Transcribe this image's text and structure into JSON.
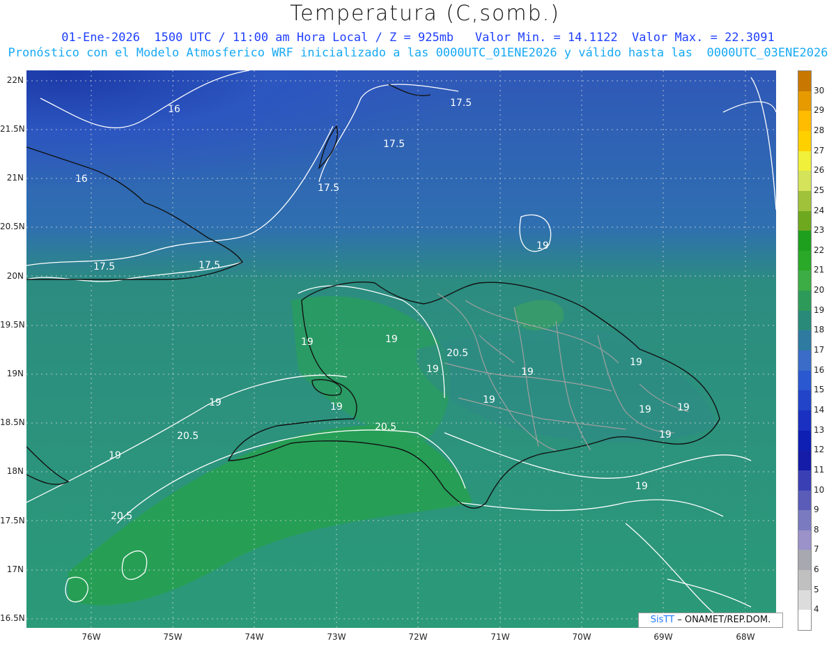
{
  "header": {
    "title": "Temperatura (C,somb.)",
    "line1": "01-Ene-2026  1500 UTC / 11:00 am Hora Local / Z = 925mb   Valor Min. = 14.1122  Valor Max. = 22.3091",
    "line2": "Pronóstico con el Modelo Atmosferico WRF inicializado a las 0000UTC_01ENE2026 y válido hasta las  0000UTC_03ENE2026"
  },
  "axes": {
    "y_labels": [
      "22N",
      "21.5N",
      "21N",
      "20.5N",
      "20N",
      "19.5N",
      "19N",
      "18.5N",
      "18N",
      "17.5N",
      "17N",
      "16.5N"
    ],
    "x_labels": [
      "76W",
      "75W",
      "74W",
      "73W",
      "72W",
      "71W",
      "70W",
      "69W",
      "68W"
    ]
  },
  "contour_labels": [
    "16",
    "16",
    "17.5",
    "17.5",
    "17.5",
    "17.5",
    "17.5",
    "19",
    "19",
    "19",
    "19",
    "19",
    "19",
    "19",
    "19",
    "19",
    "19",
    "19",
    "19",
    "19",
    "19",
    "20.5",
    "20.5",
    "20.5",
    "20.5"
  ],
  "colorbar": {
    "labels": [
      "30",
      "29",
      "28",
      "27",
      "26",
      "25",
      "24",
      "23",
      "22",
      "21",
      "20",
      "19",
      "18",
      "17",
      "16",
      "15",
      "14",
      "13",
      "12",
      "11",
      "10",
      "9",
      "8",
      "7",
      "6",
      "5",
      "4"
    ],
    "colors": [
      "#c87800",
      "#e69a00",
      "#ffbc00",
      "#ffd000",
      "#f0f03a",
      "#d4e35a",
      "#a0c23a",
      "#6ea81e",
      "#1ea01e",
      "#2aa828",
      "#3cac44",
      "#2e9a5a",
      "#2a8a7a",
      "#2e7aa0",
      "#3a6cc8",
      "#2a58d0",
      "#2244c8",
      "#1a30c0",
      "#0e20b4",
      "#141ca8",
      "#3a40b4",
      "#5a5cb8",
      "#7a7ac0",
      "#9a92c8",
      "#a8a8b0",
      "#c0c0c0",
      "#dcdcdc",
      "#ffffff"
    ]
  },
  "credit": {
    "brand": "SisTT",
    "text": "– ONAMET/REP.DOM."
  }
}
